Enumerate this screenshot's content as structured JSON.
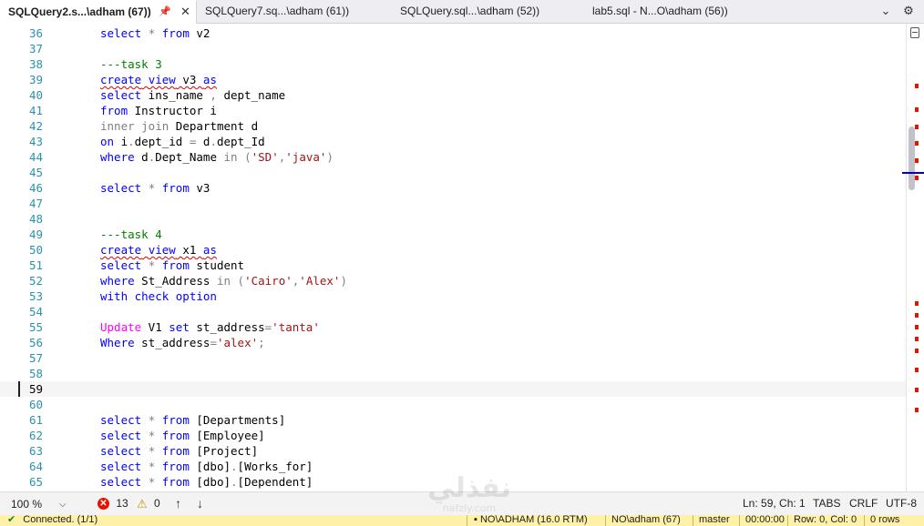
{
  "tabs": [
    {
      "label": "SQLQuery2.s...\\adham (67))",
      "active": true
    },
    {
      "label": "SQLQuery7.sq...\\adham (61))",
      "active": false
    },
    {
      "label": "SQLQuery.sql...\\adham (52))",
      "active": false
    },
    {
      "label": "lab5.sql - N...O\\adham (56))",
      "active": false
    }
  ],
  "lines": [
    {
      "n": "36",
      "tokens": [
        [
          "kw",
          "select"
        ],
        [
          "t",
          " "
        ],
        [
          "op",
          "*"
        ],
        [
          "t",
          " "
        ],
        [
          "kw",
          "from"
        ],
        [
          "t",
          " v2"
        ]
      ]
    },
    {
      "n": "37",
      "tokens": []
    },
    {
      "n": "38",
      "tokens": [
        [
          "cm",
          "---task 3"
        ]
      ]
    },
    {
      "n": "39",
      "tokens": [
        [
          "kwsq",
          "create"
        ],
        [
          "sq",
          " "
        ],
        [
          "kwsq",
          "view"
        ],
        [
          "sq",
          " v3 "
        ],
        [
          "kwsq",
          "as"
        ]
      ]
    },
    {
      "n": "40",
      "tokens": [
        [
          "kw",
          "select"
        ],
        [
          "t",
          " ins_name "
        ],
        [
          "op",
          ","
        ],
        [
          "t",
          " dept_name"
        ]
      ]
    },
    {
      "n": "41",
      "tokens": [
        [
          "kw",
          "from"
        ],
        [
          "t",
          " Instructor i"
        ]
      ]
    },
    {
      "n": "42",
      "tokens": [
        [
          "gr",
          "inner join"
        ],
        [
          "t",
          " Department d"
        ]
      ]
    },
    {
      "n": "43",
      "tokens": [
        [
          "kw",
          "on"
        ],
        [
          "t",
          " i"
        ],
        [
          "op",
          "."
        ],
        [
          "t",
          "dept_id "
        ],
        [
          "op",
          "="
        ],
        [
          "t",
          " d"
        ],
        [
          "op",
          "."
        ],
        [
          "t",
          "dept_Id"
        ]
      ]
    },
    {
      "n": "44",
      "tokens": [
        [
          "kw",
          "where"
        ],
        [
          "t",
          " d"
        ],
        [
          "op",
          "."
        ],
        [
          "t",
          "Dept_Name "
        ],
        [
          "gr",
          "in"
        ],
        [
          "t",
          " "
        ],
        [
          "op",
          "("
        ],
        [
          "str",
          "'SD'"
        ],
        [
          "op",
          ","
        ],
        [
          "str",
          "'java'"
        ],
        [
          "op",
          ")"
        ]
      ]
    },
    {
      "n": "45",
      "tokens": []
    },
    {
      "n": "46",
      "tokens": [
        [
          "kw",
          "select"
        ],
        [
          "t",
          " "
        ],
        [
          "op",
          "*"
        ],
        [
          "t",
          " "
        ],
        [
          "kw",
          "from"
        ],
        [
          "t",
          " v3"
        ]
      ]
    },
    {
      "n": "47",
      "tokens": []
    },
    {
      "n": "48",
      "tokens": []
    },
    {
      "n": "49",
      "tokens": [
        [
          "cm",
          "---task 4"
        ]
      ]
    },
    {
      "n": "50",
      "tokens": [
        [
          "kwsq",
          "create"
        ],
        [
          "sq",
          " "
        ],
        [
          "kwsq",
          "view"
        ],
        [
          "sq",
          " x1 "
        ],
        [
          "kwsq",
          "as"
        ]
      ]
    },
    {
      "n": "51",
      "tokens": [
        [
          "kw",
          "select"
        ],
        [
          "t",
          " "
        ],
        [
          "op",
          "*"
        ],
        [
          "t",
          " "
        ],
        [
          "kw",
          "from"
        ],
        [
          "t",
          " student"
        ]
      ]
    },
    {
      "n": "52",
      "tokens": [
        [
          "kw",
          "where"
        ],
        [
          "t",
          " St_Address "
        ],
        [
          "gr",
          "in"
        ],
        [
          "t",
          " "
        ],
        [
          "op",
          "("
        ],
        [
          "str",
          "'Cairo'"
        ],
        [
          "op",
          ","
        ],
        [
          "str",
          "'Alex'"
        ],
        [
          "op",
          ")"
        ]
      ]
    },
    {
      "n": "53",
      "tokens": [
        [
          "kw",
          "with check option"
        ]
      ]
    },
    {
      "n": "54",
      "tokens": []
    },
    {
      "n": "55",
      "tokens": [
        [
          "fn",
          "Update"
        ],
        [
          "t",
          " V1 "
        ],
        [
          "kw",
          "set"
        ],
        [
          "t",
          " st_address"
        ],
        [
          "op",
          "="
        ],
        [
          "str",
          "'tanta'"
        ]
      ]
    },
    {
      "n": "56",
      "tokens": [
        [
          "kw",
          "Where"
        ],
        [
          "t",
          " st_address"
        ],
        [
          "op",
          "="
        ],
        [
          "str",
          "'alex'"
        ],
        [
          "op",
          ";"
        ]
      ]
    },
    {
      "n": "57",
      "tokens": []
    },
    {
      "n": "58",
      "tokens": []
    },
    {
      "n": "59",
      "tokens": [],
      "current": true
    },
    {
      "n": "60",
      "tokens": []
    },
    {
      "n": "61",
      "tokens": [
        [
          "kw",
          "select"
        ],
        [
          "t",
          " "
        ],
        [
          "op",
          "*"
        ],
        [
          "t",
          " "
        ],
        [
          "kw",
          "from"
        ],
        [
          "t",
          " [Departments]"
        ]
      ]
    },
    {
      "n": "62",
      "tokens": [
        [
          "kw",
          "select"
        ],
        [
          "t",
          " "
        ],
        [
          "op",
          "*"
        ],
        [
          "t",
          " "
        ],
        [
          "kw",
          "from"
        ],
        [
          "t",
          " [Employee]"
        ]
      ]
    },
    {
      "n": "63",
      "tokens": [
        [
          "kw",
          "select"
        ],
        [
          "t",
          " "
        ],
        [
          "op",
          "*"
        ],
        [
          "t",
          " "
        ],
        [
          "kw",
          "from"
        ],
        [
          "t",
          " [Project]"
        ]
      ]
    },
    {
      "n": "64",
      "tokens": [
        [
          "kw",
          "select"
        ],
        [
          "t",
          " "
        ],
        [
          "op",
          "*"
        ],
        [
          "t",
          " "
        ],
        [
          "kw",
          "from"
        ],
        [
          "t",
          " [dbo]"
        ],
        [
          "op",
          "."
        ],
        [
          "t",
          "[Works_for]"
        ]
      ]
    },
    {
      "n": "65",
      "tokens": [
        [
          "kw",
          "select"
        ],
        [
          "t",
          " "
        ],
        [
          "op",
          "*"
        ],
        [
          "t",
          " "
        ],
        [
          "kw",
          "from"
        ],
        [
          "t",
          " [dbo]"
        ],
        [
          "op",
          "."
        ],
        [
          "t",
          "[Dependent]"
        ]
      ]
    }
  ],
  "status": {
    "zoom": "100 %",
    "errors": "13",
    "warnings": "0",
    "position": "Ln: 59, Ch: 1",
    "indent": "TABS",
    "line_ending": "CRLF",
    "encoding": "UTF-8"
  },
  "connection": {
    "state": "Connected. (1/1)",
    "server": "NO\\ADHAM (16.0 RTM)",
    "user": "NO\\adham (67)",
    "database": "master",
    "time": "00:00:00",
    "rows": "0 rows"
  },
  "watermark": {
    "text": "نفذلي"
  },
  "colors": {
    "keyword": "#0000ff",
    "string": "#a31515",
    "comment": "#008000",
    "function": "#ff00ff",
    "gray": "#808080",
    "linenum": "#2b91af",
    "error": "#e51400",
    "connbar": "#fff2a8"
  }
}
